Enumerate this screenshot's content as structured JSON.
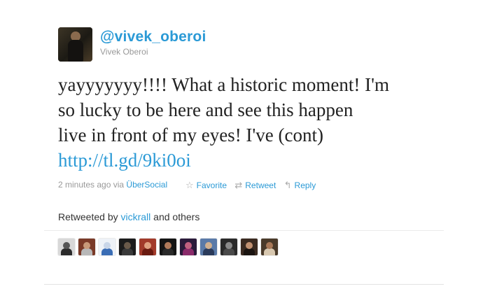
{
  "user": {
    "handle": "@vivek_oberoi",
    "name": "Vivek Oberoi"
  },
  "tweet": {
    "lines": [
      "yayyyyyyy!!!! What a historic moment! I'm",
      "so lucky to be here and see this happen",
      "live in front of my eyes! I've (cont)"
    ],
    "link": "http://tl.gd/9ki0oi"
  },
  "meta": {
    "time": "2 minutes ago",
    "via": "via",
    "source": "ÜberSocial"
  },
  "actions": {
    "favorite": "Favorite",
    "retweet": "Retweet",
    "reply": "Reply"
  },
  "retweeted": {
    "prefix": "Retweeted by",
    "user": "vickrall",
    "suffix": "and others"
  },
  "colors": {
    "link": "#2b9ad6",
    "muted": "#999999"
  },
  "retweeter_avatars": [
    {
      "bg": "#d8d8d8",
      "face": "#555555",
      "body": "#2a2a2a"
    },
    {
      "bg": "#7a3a28",
      "face": "#c89a7a",
      "body": "#b8b8b8"
    },
    {
      "bg": "#eef2f7",
      "face": "#c9d6e8",
      "body": "#3a6db5"
    },
    {
      "bg": "#1c1c1c",
      "face": "#6a5a4a",
      "body": "#3a3a3a"
    },
    {
      "bg": "#a23a2a",
      "face": "#e0a080",
      "body": "#6a1a10"
    },
    {
      "bg": "#141414",
      "face": "#b07a5a",
      "body": "#2a2a2a"
    },
    {
      "bg": "#2a1a3a",
      "face": "#c06080",
      "body": "#8a2a6a"
    },
    {
      "bg": "#5a7aa8",
      "face": "#d0b090",
      "body": "#2a3a5a"
    },
    {
      "bg": "#2a2a2a",
      "face": "#8a8a8a",
      "body": "#4a4a4a"
    },
    {
      "bg": "#3a2a20",
      "face": "#c09070",
      "body": "#1a1410"
    },
    {
      "bg": "#4a3a2a",
      "face": "#a87858",
      "body": "#d8c8b0"
    }
  ]
}
